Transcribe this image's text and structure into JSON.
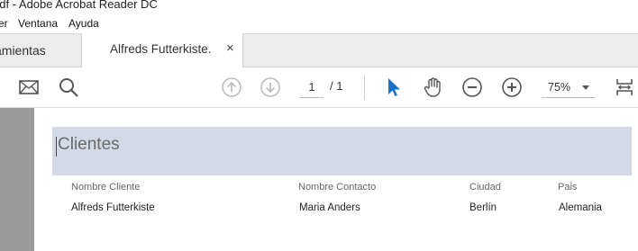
{
  "window": {
    "title": "odf - Adobe Acrobat Reader DC"
  },
  "menu": {
    "items": [
      "er",
      "Ventana",
      "Ayuda"
    ]
  },
  "tabs": {
    "tools_label": "amientas",
    "doc_label": "Alfreds Futterkiste.",
    "close": "×"
  },
  "toolbar": {
    "icons": [
      "mail-icon",
      "search-icon",
      "page-up-icon",
      "page-down-icon",
      "select-arrow-icon",
      "hand-tool-icon",
      "zoom-out-icon",
      "zoom-in-icon",
      "fit-page-icon"
    ],
    "page_current": "1",
    "page_total": "/ 1",
    "zoom": "75%"
  },
  "document": {
    "title": "Clientes",
    "columns": [
      "Nombre Cliente",
      "Nombre Contacto",
      "Ciudad",
      "Pais"
    ],
    "rows": [
      [
        "Alfreds Futterkiste",
        "Maria Anders",
        "Berlín",
        "Alemania"
      ]
    ]
  },
  "colors": {
    "accent": "#1a73c8",
    "header_band": "#d3dae5",
    "left_pane": "#9b9b9b"
  }
}
